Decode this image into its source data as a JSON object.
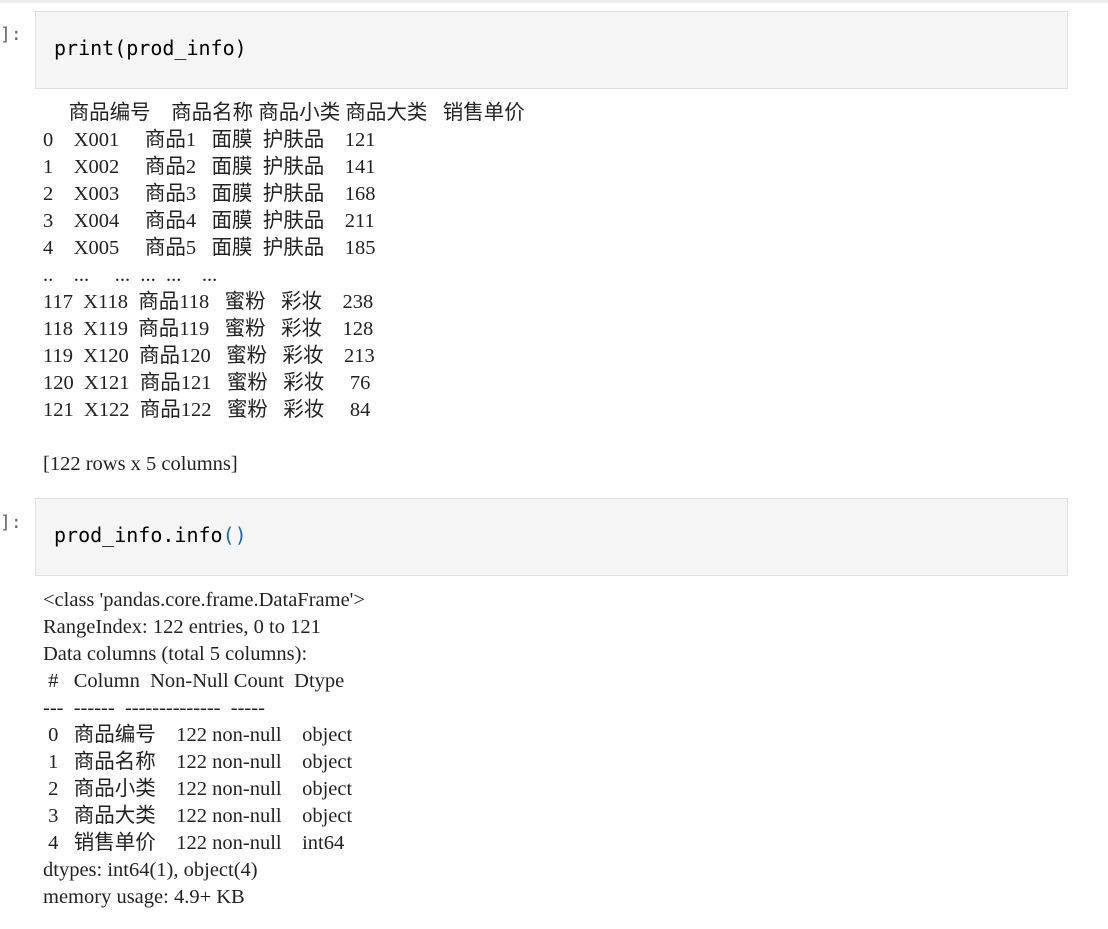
{
  "cells": [
    {
      "prompt": "]:",
      "code": {
        "func": "print",
        "open": "(",
        "arg": "prod_info",
        "close": ")"
      },
      "output": [
        "     商品编号    商品名称 商品小类 商品大类   销售单价",
        "0    X001     商品1   面膜  护肤品    121",
        "1    X002     商品2   面膜  护肤品    141",
        "2    X003     商品3   面膜  护肤品    168",
        "3    X004     商品4   面膜  护肤品    211",
        "4    X005     商品5   面膜  护肤品    185",
        "..    ...     ...  ...  ...    ...",
        "117  X118  商品118   蜜粉   彩妆    238",
        "118  X119  商品119   蜜粉   彩妆    128",
        "119  X120  商品120   蜜粉   彩妆    213",
        "120  X121  商品121   蜜粉   彩妆     76",
        "121  X122  商品122   蜜粉   彩妆     84",
        "",
        "[122 rows x 5 columns]"
      ]
    },
    {
      "prompt": "]:",
      "code": {
        "obj": "prod_info",
        "dot": ".",
        "method": "info",
        "call": "()"
      },
      "output": [
        "<class 'pandas.core.frame.DataFrame'>",
        "RangeIndex: 122 entries, 0 to 121",
        "Data columns (total 5 columns):",
        " #   Column  Non-Null Count  Dtype ",
        "---  ------  --------------  ----- ",
        " 0   商品编号    122 non-null    object",
        " 1   商品名称    122 non-null    object",
        " 2   商品小类    122 non-null    object",
        " 3   商品大类    122 non-null    object",
        " 4   销售单价    122 non-null    int64 ",
        "dtypes: int64(1), object(4)",
        "memory usage: 4.9+ KB"
      ]
    }
  ]
}
